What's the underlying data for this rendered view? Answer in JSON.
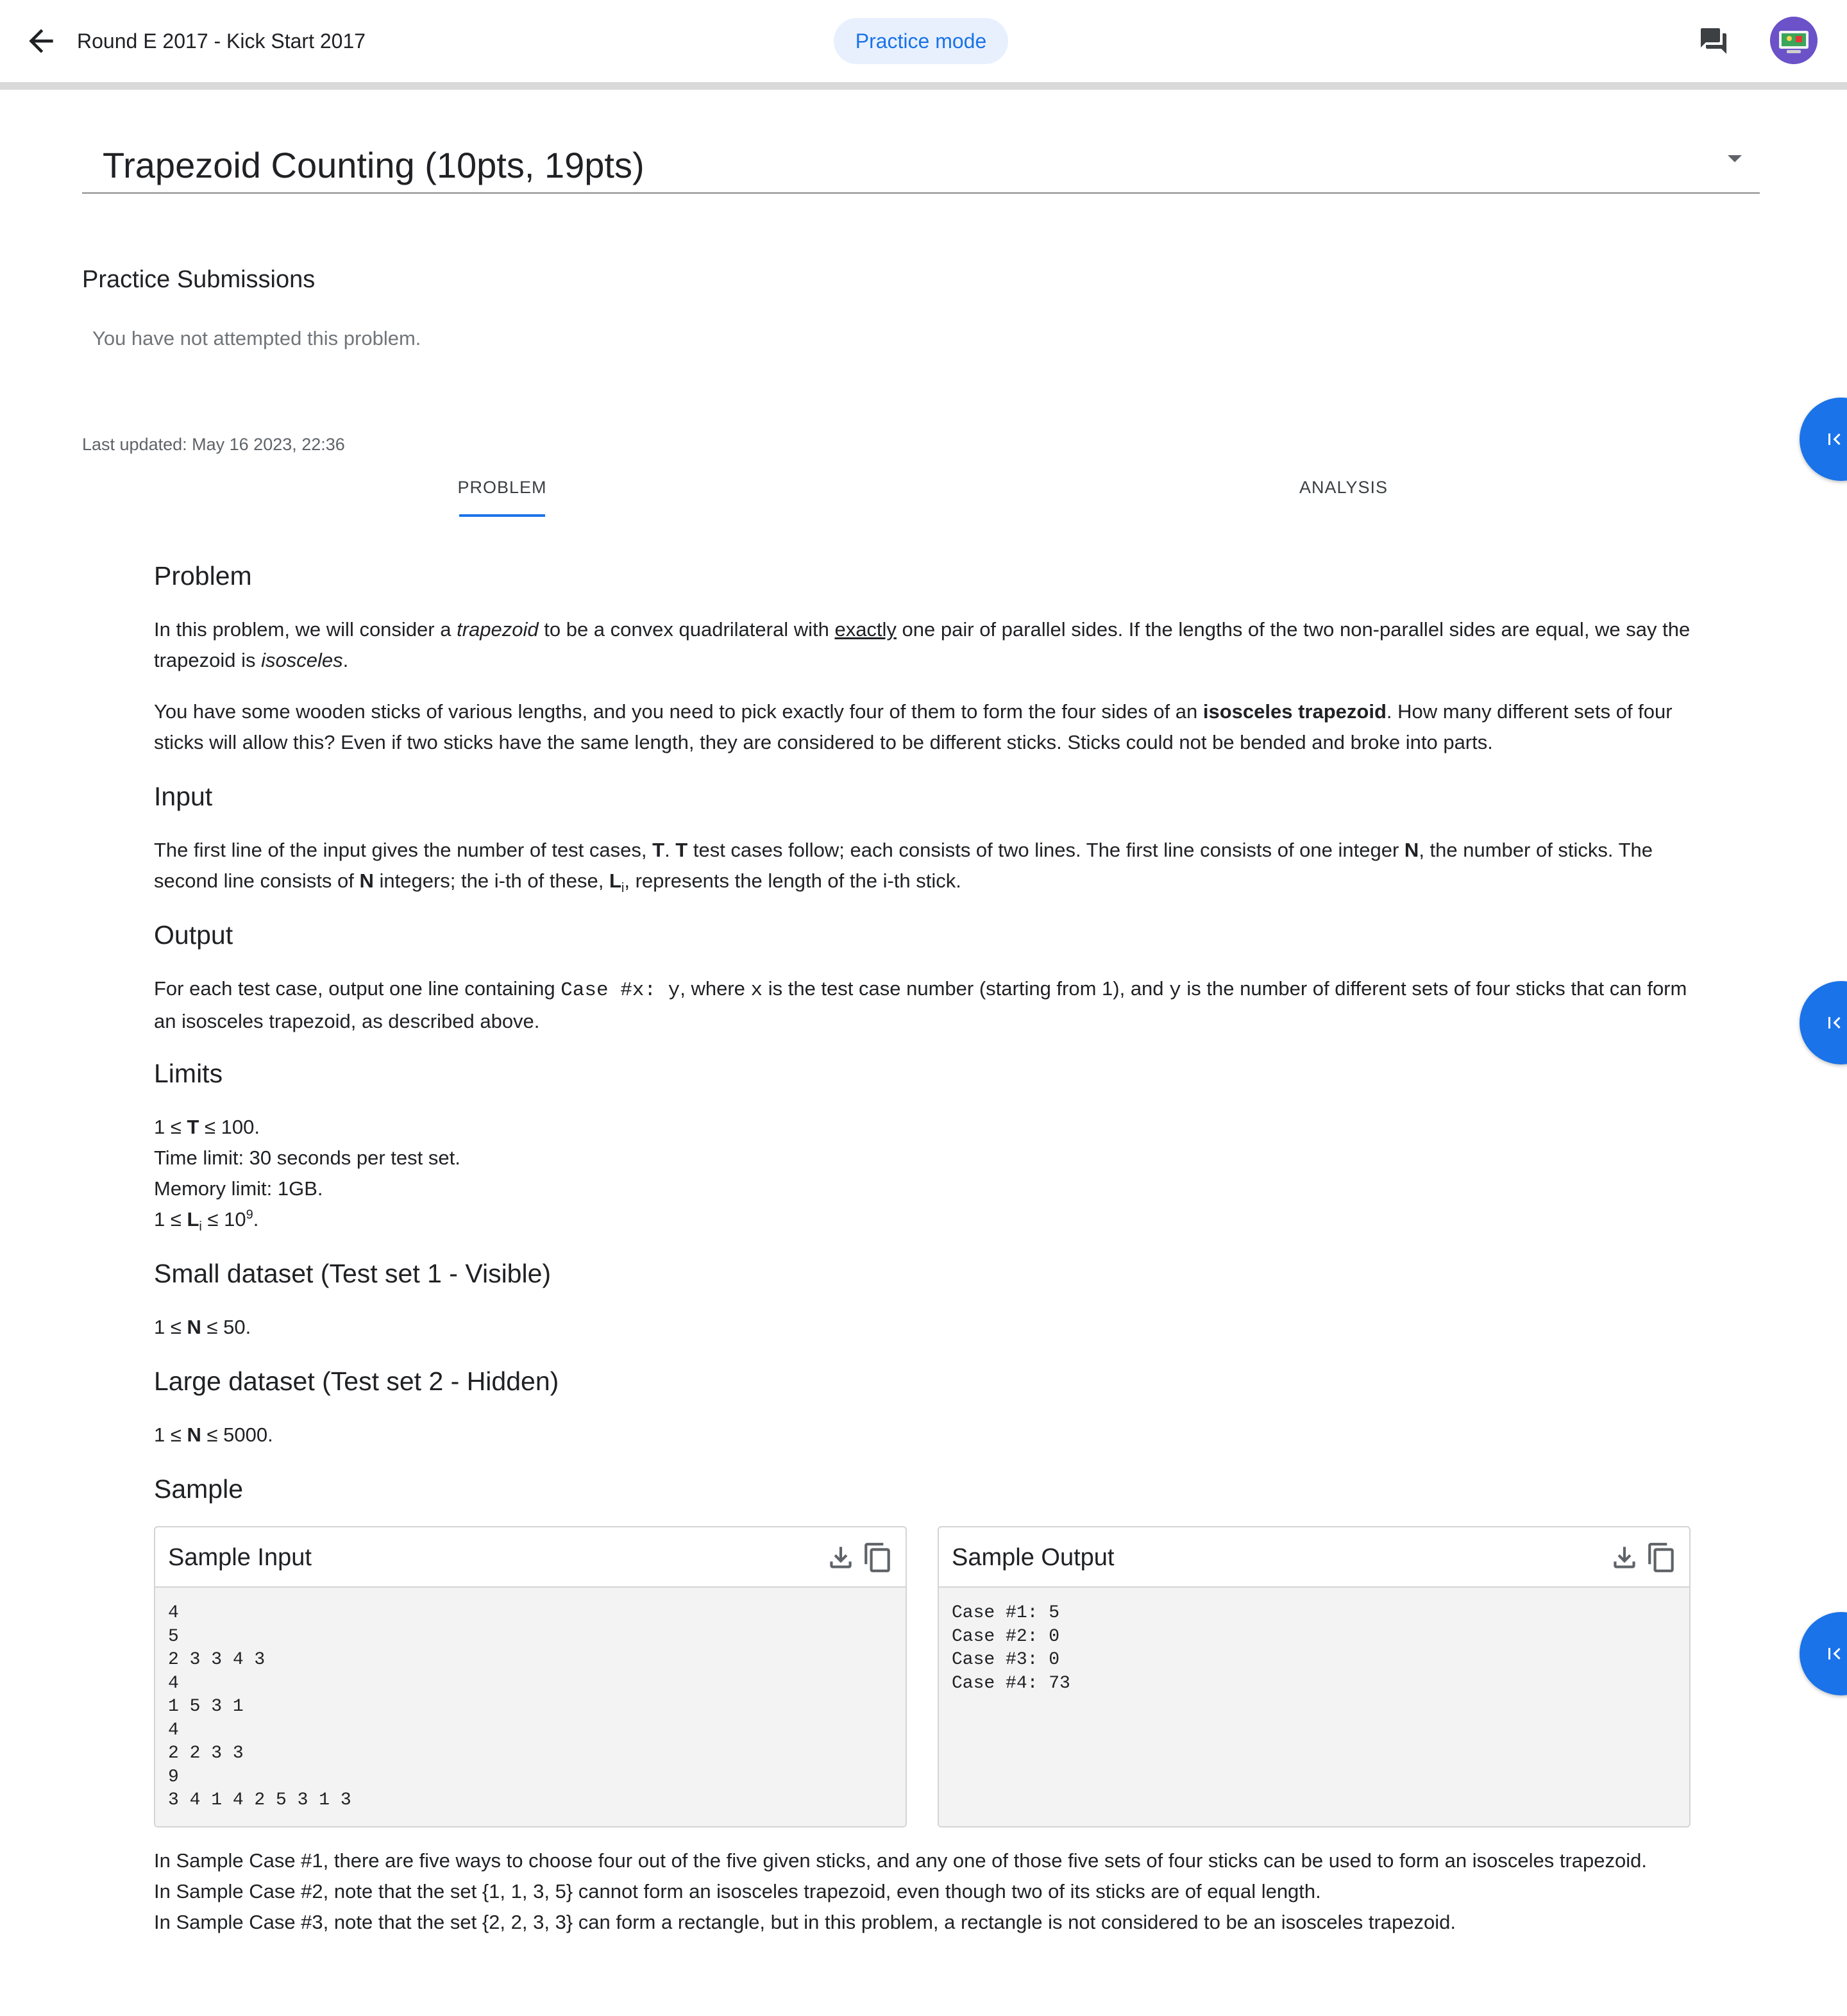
{
  "header": {
    "title": "Round E 2017 - Kick Start 2017",
    "mode_chip": "Practice mode",
    "back_icon": "arrow-back-icon",
    "chat_icon": "forum-icon",
    "avatar_icon": "user-avatar-icon"
  },
  "problem_selector": {
    "title": "Trapezoid Counting (10pts, 19pts)"
  },
  "submissions": {
    "heading": "Practice Submissions",
    "empty_text": "You have not attempted this problem."
  },
  "last_updated": "Last updated: May 16 2023, 22:36",
  "tabs": [
    {
      "label": "PROBLEM",
      "selected": true
    },
    {
      "label": "ANALYSIS",
      "selected": false
    }
  ],
  "side_buttons": [
    "first-page-icon",
    "first-page-icon",
    "first-page-icon"
  ],
  "statement": {
    "problem_heading": "Problem",
    "p1": {
      "a": "In this problem, we will consider a ",
      "b": "trapezoid",
      "c": " to be a convex quadrilateral with ",
      "d": "exactly",
      "e": " one pair of parallel sides. If the lengths of the two non-parallel sides are equal, we say the trapezoid is ",
      "f": "isosceles",
      "g": "."
    },
    "p2": {
      "a": "You have some wooden sticks of various lengths, and you need to pick exactly four of them to form the four sides of an ",
      "b": "isosceles trapezoid",
      "c": ". How many different sets of four sticks will allow this? Even if two sticks have the same length, they are considered to be different sticks. Sticks could not be bended and broke into parts."
    },
    "input_heading": "Input",
    "input": {
      "a": "The first line of the input gives the number of test cases, ",
      "b": "T",
      "c": ". ",
      "d": "T",
      "e": " test cases follow; each consists of two lines. The first line consists of one integer ",
      "f": "N",
      "g": ", the number of sticks. The second line consists of ",
      "h": "N",
      "i": " integers; the i-th of these, ",
      "j": "L",
      "k": "i",
      "l": ", represents the length of the i-th stick."
    },
    "output_heading": "Output",
    "output": {
      "a": "For each test case, output one line containing ",
      "b": "Case #x: y",
      "c": ", where ",
      "d": "x",
      "e": " is the test case number (starting from 1), and ",
      "f": "y",
      "g": " is the number of different sets of four sticks that can form an isosceles trapezoid, as described above."
    },
    "limits_heading": "Limits",
    "limits": {
      "l1a": "1 ≤ ",
      "l1b": "T",
      "l1c": " ≤ 100.",
      "l2": "Time limit: 30 seconds per test set.",
      "l3": "Memory limit: 1GB.",
      "l4a": "1 ≤ ",
      "l4b": "L",
      "l4c": "i",
      "l4d": " ≤ 10",
      "l4e": "9",
      "l4f": "."
    },
    "small_heading": "Small dataset (Test set 1 - Visible)",
    "small": {
      "a": "1 ≤ ",
      "b": "N",
      "c": " ≤ 50."
    },
    "large_heading": "Large dataset (Test set 2 - Hidden)",
    "large": {
      "a": "1 ≤ ",
      "b": "N",
      "c": " ≤ 5000."
    },
    "sample_heading": "Sample"
  },
  "sample_input": {
    "title": "Sample Input",
    "text": "4\n5\n2 3 3 4 3\n4\n1 5 3 1\n4\n2 2 3 3\n9\n3 4 1 4 2 5 3 1 3"
  },
  "sample_output": {
    "title": "Sample Output",
    "text": "Case #1: 5\nCase #2: 0\nCase #3: 0\nCase #4: 73"
  },
  "explanations": [
    "In Sample Case #1, there are five ways to choose four out of the five given sticks, and any one of those five sets of four sticks can be used to form an isosceles trapezoid.",
    "In Sample Case #2, note that the set {1, 1, 3, 5} cannot form an isosceles trapezoid, even though two of its sticks are of equal length.",
    "In Sample Case #3, note that the set {2, 2, 3, 3} can form a rectangle, but in this problem, a rectangle is not considered to be an isosceles trapezoid."
  ],
  "colors": {
    "accent": "#1a73e8",
    "chip_background": "#e8f0fe",
    "avatar": "#6b52c8"
  }
}
